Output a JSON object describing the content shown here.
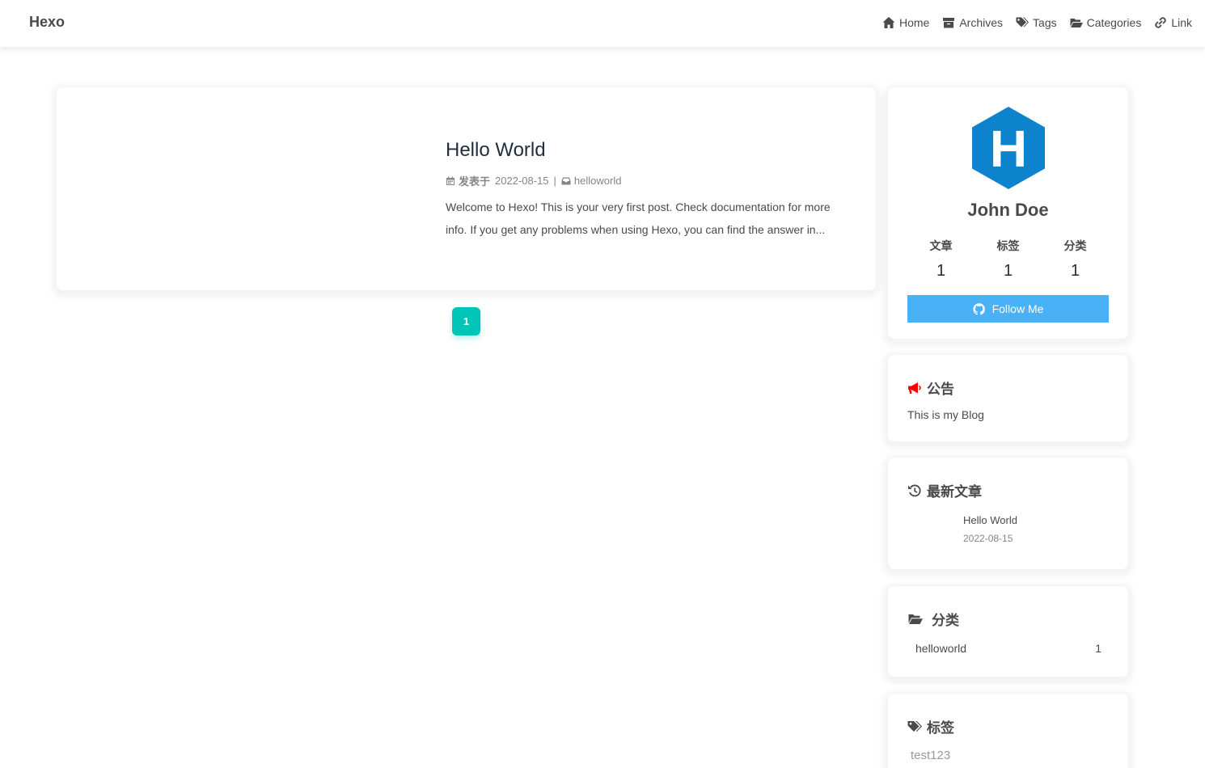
{
  "site": {
    "brand": "Hexo"
  },
  "nav": [
    {
      "label": "Home",
      "icon": "home-icon"
    },
    {
      "label": "Archives",
      "icon": "archive-icon"
    },
    {
      "label": "Tags",
      "icon": "tags-icon"
    },
    {
      "label": "Categories",
      "icon": "folder-open-icon"
    },
    {
      "label": "Link",
      "icon": "link-icon"
    }
  ],
  "post": {
    "title": "Hello World",
    "meta_label": "发表于",
    "date": "2022-08-15",
    "separator": "|",
    "category": "helloworld",
    "excerpt_line1": "Welcome to Hexo! This is your very first post. Check documentation for more",
    "excerpt_line2": "info. If you get any problems when using Hexo, you can find the answer in..."
  },
  "pagination": {
    "current": "1"
  },
  "author": {
    "name": "John Doe",
    "avatar_letter": "H",
    "stats": [
      {
        "label": "文章",
        "value": "1"
      },
      {
        "label": "标签",
        "value": "1"
      },
      {
        "label": "分类",
        "value": "1"
      }
    ],
    "follow_label": "Follow Me"
  },
  "announcement": {
    "title": "公告",
    "text": "This is my Blog"
  },
  "recent": {
    "title": "最新文章",
    "items": [
      {
        "title": "Hello World",
        "date": "2022-08-15"
      }
    ]
  },
  "categories": {
    "title": "分类",
    "items": [
      {
        "name": "helloworld",
        "count": "1"
      }
    ]
  },
  "tags": {
    "title": "标签",
    "items": [
      "test123"
    ]
  },
  "colors": {
    "accent": "#49b1f5",
    "pager": "#00c4b6",
    "announce_icon": "#ff0000",
    "avatar_hex": "#0e83cd"
  }
}
